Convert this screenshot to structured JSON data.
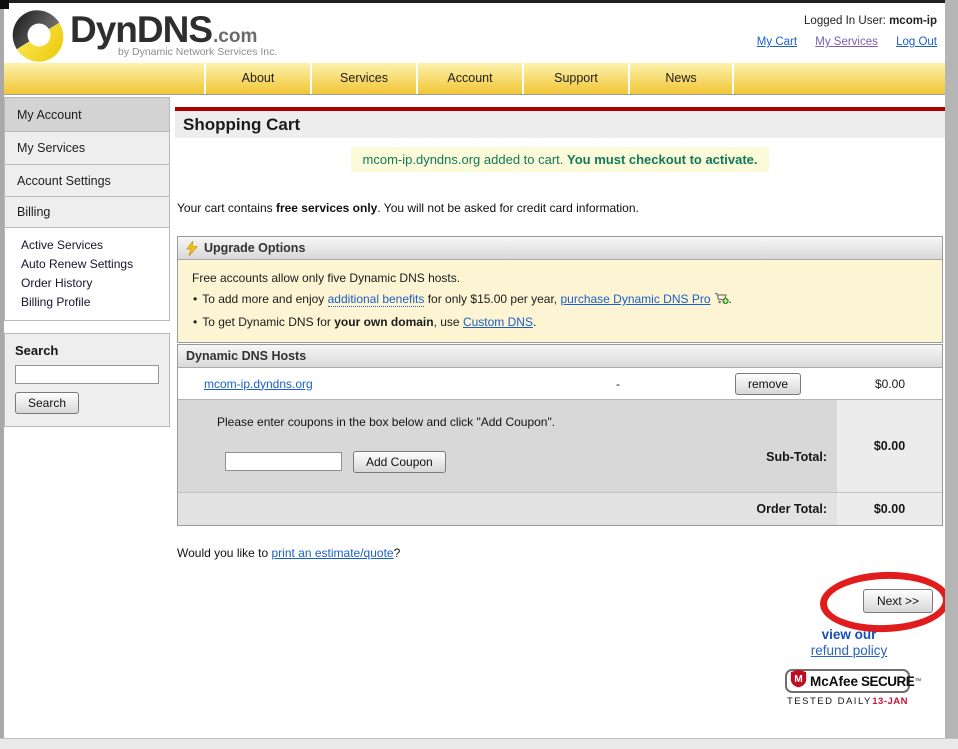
{
  "colors": {
    "nav_yellow_top": "#fdf2ae",
    "nav_yellow_bottom": "#f2c636",
    "red_bar": "#aa0202",
    "notice_green": "#13795a",
    "notice_bg": "#fbfbd9",
    "link_blue": "#1b5fc8",
    "visited_purple": "#7b5fae",
    "annotation_red": "#e01c1c",
    "mcafee_red": "#c00c1e"
  },
  "header": {
    "logo_brand": "DynDNS",
    "logo_tld": ".com",
    "logo_tagline": "by Dynamic Network Services Inc.",
    "logged_in_label": "Logged In User:",
    "logged_in_user": "mcom-ip",
    "link_my_cart": "My Cart",
    "link_my_services": "My Services",
    "link_log_out": "Log Out"
  },
  "nav": {
    "items": [
      "About",
      "Services",
      "Account",
      "Support",
      "News"
    ]
  },
  "sidebar": {
    "my_account": "My Account",
    "my_services": "My Services",
    "account_settings": "Account Settings",
    "billing": "Billing",
    "billing_sub": [
      "Active Services",
      "Auto Renew Settings",
      "Order History",
      "Billing Profile"
    ],
    "search_label": "Search",
    "search_button": "Search",
    "search_value": ""
  },
  "main": {
    "title": "Shopping Cart",
    "notice_text": "mcom-ip.dyndns.org added to cart. ",
    "notice_bold": "You must checkout to activate.",
    "cart_info_pre": "Your cart contains ",
    "cart_info_bold": "free services only",
    "cart_info_post": ". You will not be asked for credit card information.",
    "upgrade": {
      "title": "Upgrade Options",
      "line1": "Free accounts allow only five Dynamic DNS hosts.",
      "b1_pre": "To add more and enjoy ",
      "b1_link1": "additional benefits",
      "b1_mid": " for only $15.00 per year, ",
      "b1_link2": "purchase Dynamic DNS Pro",
      "b1_post": ".",
      "b2_pre": "To get Dynamic DNS for ",
      "b2_bold": "your own domain",
      "b2_mid": ", use ",
      "b2_link": "Custom DNS",
      "b2_post": "."
    },
    "hosts": {
      "header": "Dynamic DNS Hosts",
      "host_link": "mcom-ip.dyndns.org",
      "dash": "-",
      "remove_button": "remove",
      "price": "$0.00",
      "coupon_instruction": "Please enter coupons in the box below and click \"Add Coupon\".",
      "coupon_value": "",
      "add_coupon_button": "Add Coupon",
      "subtotal_label": "Sub-Total:",
      "subtotal_value": "$0.00",
      "order_total_label": "Order Total:",
      "order_total_value": "$0.00"
    },
    "estimate_pre": "Would you like to ",
    "estimate_link": "print an estimate/quote",
    "estimate_post": "?",
    "next_button": "Next >>",
    "view_our": "view our",
    "refund_policy": "refund policy",
    "mcafee": {
      "brand": "McAfee",
      "secure": "SECURE",
      "tm": "™",
      "tested": "TESTED DAILY",
      "date": "13-JAN"
    }
  }
}
